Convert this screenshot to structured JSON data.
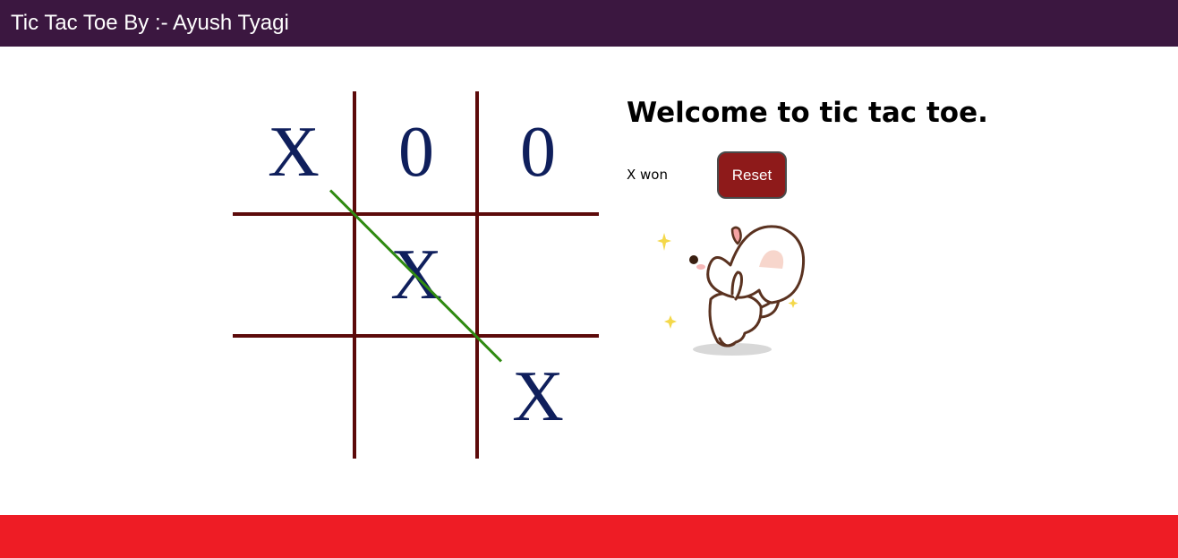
{
  "navbar": {
    "title": "Tic Tac Toe By :- Ayush Tyagi"
  },
  "board": {
    "cells": [
      "X",
      "0",
      "0",
      "",
      "X",
      "",
      "",
      "",
      "X"
    ],
    "winning_line": "diagonal top-left to bottom-right"
  },
  "info": {
    "heading": "Welcome to tic tac toe.",
    "status": "X won",
    "reset_label": "Reset"
  },
  "colors": {
    "navbar": "#3b1740",
    "grid": "#5c0a0a",
    "mark": "#0f1f5c",
    "win_line": "#2f8a11",
    "reset_button": "#8e1a1a",
    "footer": "#ee1c25"
  },
  "images": {
    "celebration": "dancing-white-cat-sticker"
  }
}
